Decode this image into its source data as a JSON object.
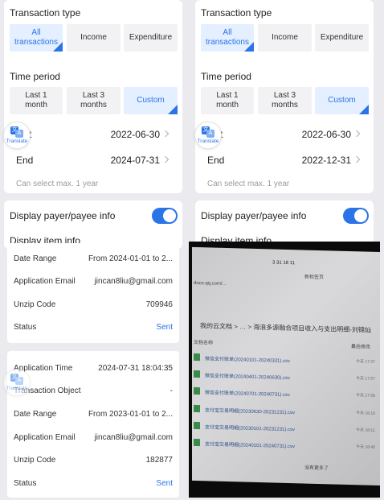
{
  "left": {
    "transaction_type_title": "Transaction type",
    "type_chips": [
      {
        "label_l1": "All",
        "label_l2": "transactions"
      },
      {
        "label": "Income"
      },
      {
        "label": "Expenditure"
      }
    ],
    "time_period_title": "Time period",
    "period_chips": [
      {
        "label_l1": "Last 1",
        "label_l2": "month"
      },
      {
        "label_l1": "Last 3",
        "label_l2": "months"
      },
      {
        "label": "Custom"
      }
    ],
    "start_label_partial": "t",
    "start_value": "2022-06-30",
    "end_label": "End",
    "end_value": "2024-07-31",
    "hint": "Can select max. 1 year",
    "display_payer_label": "Display payer/payee info",
    "display_item_label": "Display item info"
  },
  "right": {
    "transaction_type_title": "Transaction type",
    "type_chips": [
      {
        "label_l1": "All",
        "label_l2": "transactions"
      },
      {
        "label": "Income"
      },
      {
        "label": "Expenditure"
      }
    ],
    "time_period_title": "Time period",
    "period_chips": [
      {
        "label_l1": "Last 1",
        "label_l2": "month"
      },
      {
        "label_l1": "Last 3",
        "label_l2": "months"
      },
      {
        "label": "Custom"
      }
    ],
    "start_label_partial": "t",
    "start_value": "2022-06-30",
    "end_label": "End",
    "end_value": "2022-12-31",
    "hint": "Can select max. 1 year",
    "display_payer_label": "Display payer/payee info",
    "display_item_label": "Display item info"
  },
  "translate": {
    "label": "Translate",
    "glyph_a": "文",
    "glyph_b": "A"
  },
  "card1": {
    "date_range_label": "Date Range",
    "date_range_value": "From 2024-01-01 to 2...",
    "email_label": "Application Email",
    "email_value": "jincan8liu@gmail.com",
    "unzip_label": "Unzip Code",
    "unzip_value": "709946",
    "status_label": "Status",
    "status_value": "Sent"
  },
  "card2": {
    "app_time_label": "Application Time",
    "app_time_value": "2024-07-31 18:04:35",
    "object_label": "Transaction Object",
    "object_value": "-",
    "date_range_label": "Date Range",
    "date_range_value": "From 2023-01-01 to 2...",
    "email_label": "Application Email",
    "email_value": "jincan8liu@gmail.com",
    "unzip_label": "Unzip Code",
    "unzip_value": "182877",
    "status_label": "Status",
    "status_value": "Sent"
  },
  "photo": {
    "clock": "3 31 18 11",
    "tab": "新标签页",
    "url": "docs.qq.com/...",
    "breadcrumb": "我的云文档 > … > 海浪多源融合项目收入与支出明细-刘锦灿",
    "col_name": "文档名称",
    "col_modified": "最后修改",
    "files": [
      {
        "name": "微信支付账单(20240101-20240331).csv",
        "date": "今天 17:37"
      },
      {
        "name": "微信支付账单(20240401-20240630).csv",
        "date": "今天 17:57"
      },
      {
        "name": "微信支付账单(20240701-20240731).csv",
        "date": "今天 17:58"
      },
      {
        "name": "支付宝交易明细(20230630-20231231).csv",
        "date": "今天 18:10"
      },
      {
        "name": "支付宝交易明细(20230101-20231231).csv",
        "date": "今天 18:11"
      },
      {
        "name": "支付宝交易明细(20240101-20240731).csv",
        "date": "今天 18:40"
      }
    ],
    "footer": "没有更多了"
  }
}
